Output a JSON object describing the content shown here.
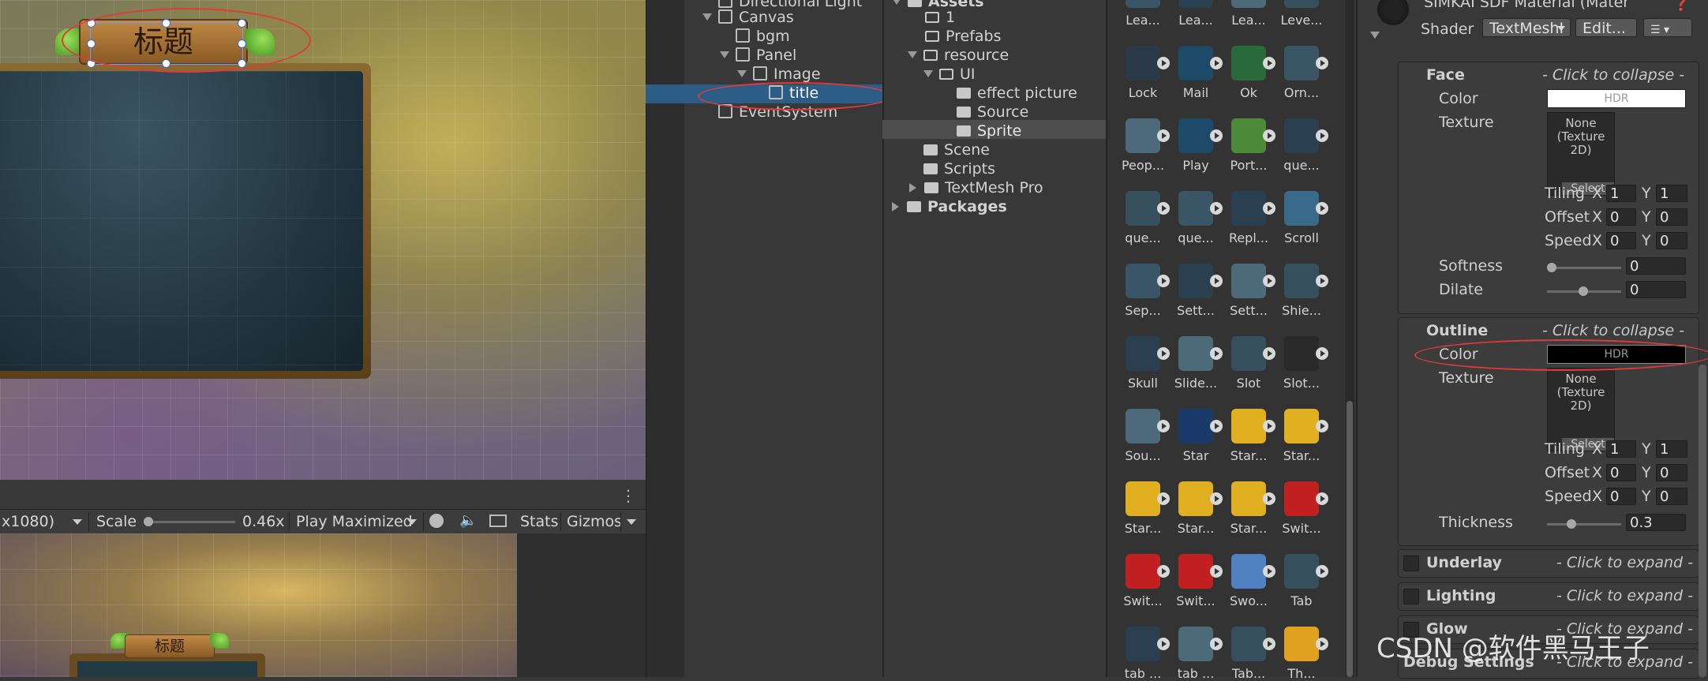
{
  "scene": {
    "title_text": "标题"
  },
  "game_toolbar": {
    "resolution": "x1080)",
    "scale_label": "Scale",
    "scale_value": "0.46x",
    "play_mode": "Play Maximized",
    "stats": "Stats",
    "gizmos": "Gizmos"
  },
  "game": {
    "title_text": "标题"
  },
  "hierarchy": {
    "items": [
      {
        "label": "Directional Light"
      },
      {
        "label": "Canvas"
      },
      {
        "label": "bgm"
      },
      {
        "label": "Panel"
      },
      {
        "label": "Image"
      },
      {
        "label": "title"
      },
      {
        "label": "EventSystem"
      }
    ]
  },
  "project_tree": {
    "items": [
      {
        "label": "Assets"
      },
      {
        "label": "1"
      },
      {
        "label": "Prefabs"
      },
      {
        "label": "resource"
      },
      {
        "label": "UI"
      },
      {
        "label": "effect picture"
      },
      {
        "label": "Source"
      },
      {
        "label": "Sprite"
      },
      {
        "label": "Scene"
      },
      {
        "label": "Scripts"
      },
      {
        "label": "TextMesh Pro"
      },
      {
        "label": "Packages"
      }
    ]
  },
  "assets": {
    "rows": [
      [
        "Lea...",
        "Lea...",
        "Lea...",
        "Leve..."
      ],
      [
        "Lock",
        "Mail",
        "Ok",
        "Orn..."
      ],
      [
        "Peop...",
        "Play",
        "Port...",
        "que..."
      ],
      [
        "que...",
        "que...",
        "Repl...",
        "Scroll"
      ],
      [
        "Sep...",
        "Sett...",
        "Sett...",
        "Shie..."
      ],
      [
        "Skull",
        "Slide...",
        "Slot",
        "Slot..."
      ],
      [
        "Sou...",
        "Star",
        "Star...",
        "Star..."
      ],
      [
        "Star...",
        "Star...",
        "Star...",
        "Swit..."
      ],
      [
        "Swit...",
        "Swit...",
        "Swo...",
        "Tab"
      ],
      [
        "tab ...",
        "tab ...",
        "Tab...",
        "Th..."
      ]
    ]
  },
  "inspector": {
    "material_name": "SIMKAI SDF Material (Mater",
    "shader_label": "Shader",
    "shader_value": "TextMeshI",
    "edit_button": "Edit...",
    "face": {
      "header": "Face",
      "hint": "- Click to collapse -",
      "color_label": "Color",
      "color_value": "HDR",
      "texture_label": "Texture",
      "texture_none": "None",
      "texture_type": "(Texture 2D)",
      "select": "Select",
      "tiling_label": "Tiling",
      "tiling_x": "1",
      "tiling_y": "1",
      "offset_label": "Offset",
      "offset_x": "0",
      "offset_y": "0",
      "speed_label": "Speed",
      "speed_x": "0",
      "speed_y": "0",
      "softness_label": "Softness",
      "softness_value": "0",
      "dilate_label": "Dilate",
      "dilate_value": "0"
    },
    "outline": {
      "header": "Outline",
      "hint": "- Click to collapse -",
      "color_label": "Color",
      "color_value": "HDR",
      "texture_label": "Texture",
      "texture_none": "None",
      "texture_type": "(Texture 2D)",
      "select": "Select",
      "tiling_label": "Tiling",
      "tiling_x": "1",
      "tiling_y": "1",
      "offset_label": "Offset",
      "offset_x": "0",
      "offset_y": "0",
      "speed_label": "Speed",
      "speed_x": "0",
      "speed_y": "0",
      "thickness_label": "Thickness",
      "thickness_value": "0.3"
    },
    "sections": [
      {
        "label": "Underlay",
        "hint": "- Click to expand -"
      },
      {
        "label": "Lighting",
        "hint": "- Click to expand -"
      },
      {
        "label": "Glow",
        "hint": "- Click to expand -"
      },
      {
        "label": "Debug Settings",
        "hint": "- Click to expand -"
      }
    ],
    "x": "X",
    "y": "Y"
  },
  "watermark": "CSDN @软件黑马王子",
  "colors": {
    "selection": "#2c5d87",
    "annotation_red": "#e03a3a",
    "face_color": "#ffffff",
    "outline_color": "#000000"
  }
}
